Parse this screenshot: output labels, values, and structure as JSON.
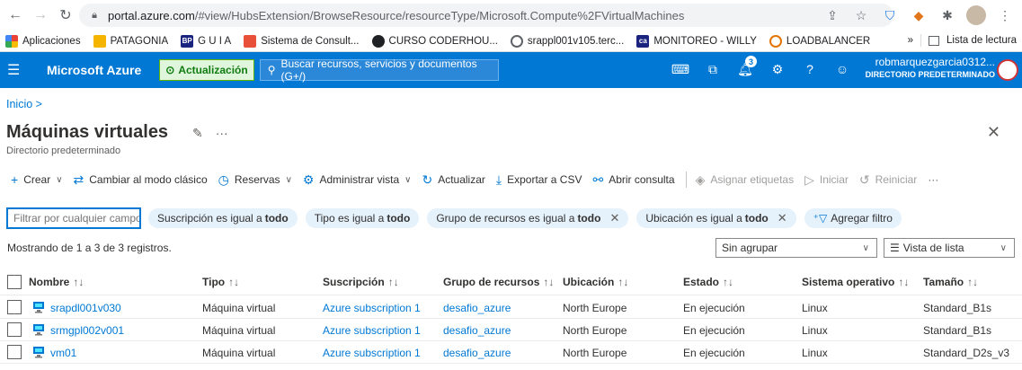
{
  "browser": {
    "url_host": "portal.azure.com",
    "url_path": "/#view/HubsExtension/BrowseResource/resourceType/Microsoft.Compute%2FVirtualMachines",
    "bookmarks": [
      {
        "label": "Aplicaciones",
        "color": "#4285f4"
      },
      {
        "label": "PATAGONIA",
        "color": "#f4b400"
      },
      {
        "label": "G U I A",
        "color": "#1a237e",
        "prefix": "BP"
      },
      {
        "label": "Sistema de Consult...",
        "color": "#e8503a"
      },
      {
        "label": "CURSO CODERHOU...",
        "color": "#202124"
      },
      {
        "label": "srappl001v105.terc...",
        "color": "#5f6368"
      },
      {
        "label": "MONITOREO - WILLY",
        "color": "#1a237e",
        "prefix": "ca"
      },
      {
        "label": "LOADBALANCER",
        "color": "#e37400"
      }
    ],
    "more": "»",
    "reading_list": "Lista de lectura"
  },
  "azure": {
    "brand": "Microsoft Azure",
    "update": "Actualización",
    "search_placeholder": "Buscar recursos, servicios y documentos (G+/)",
    "notifications": "3",
    "user_name": "robmarquezgarcia0312...",
    "user_dir": "DIRECTORIO PREDETERMINADO"
  },
  "page": {
    "breadcrumb": "Inicio  >",
    "title": "Máquinas virtuales",
    "subtitle": "Directorio predeterminado",
    "more": "···",
    "close": "✕"
  },
  "toolbar": {
    "create": "Crear",
    "classic": "Cambiar al modo clásico",
    "reservations": "Reservas",
    "manage_view": "Administrar vista",
    "refresh": "Actualizar",
    "export": "Exportar a CSV",
    "query": "Abrir consulta",
    "tags": "Asignar etiquetas",
    "start": "Iniciar",
    "restart": "Reiniciar",
    "more": "···"
  },
  "filters": {
    "placeholder": "Filtrar por cualquier campo...",
    "pills": [
      {
        "label": "Suscripción es igual a",
        "value": "todo",
        "removable": false
      },
      {
        "label": "Tipo es igual a",
        "value": "todo",
        "removable": false
      },
      {
        "label": "Grupo de recursos es igual a",
        "value": "todo",
        "removable": true
      },
      {
        "label": "Ubicación es igual a",
        "value": "todo",
        "removable": true
      }
    ],
    "add_filter": "Agregar filtro"
  },
  "results": {
    "count_text": "Mostrando de 1 a 3 de 3 registros.",
    "grouping": "Sin agrupar",
    "view": "Vista de lista"
  },
  "table": {
    "headers": [
      "Nombre",
      "Tipo",
      "Suscripción",
      "Grupo de recursos",
      "Ubicación",
      "Estado",
      "Sistema operativo",
      "Tamaño"
    ],
    "sort_glyph": "↑↓",
    "rows": [
      [
        "srapdl001v030",
        "Máquina virtual",
        "Azure subscription 1",
        "desafio_azure",
        "North Europe",
        "En ejecución",
        "Linux",
        "Standard_B1s"
      ],
      [
        "srmgpl002v001",
        "Máquina virtual",
        "Azure subscription 1",
        "desafio_azure",
        "North Europe",
        "En ejecución",
        "Linux",
        "Standard_B1s"
      ],
      [
        "vm01",
        "Máquina virtual",
        "Azure subscription 1",
        "desafio_azure",
        "North Europe",
        "En ejecución",
        "Linux",
        "Standard_D2s_v3"
      ]
    ]
  }
}
